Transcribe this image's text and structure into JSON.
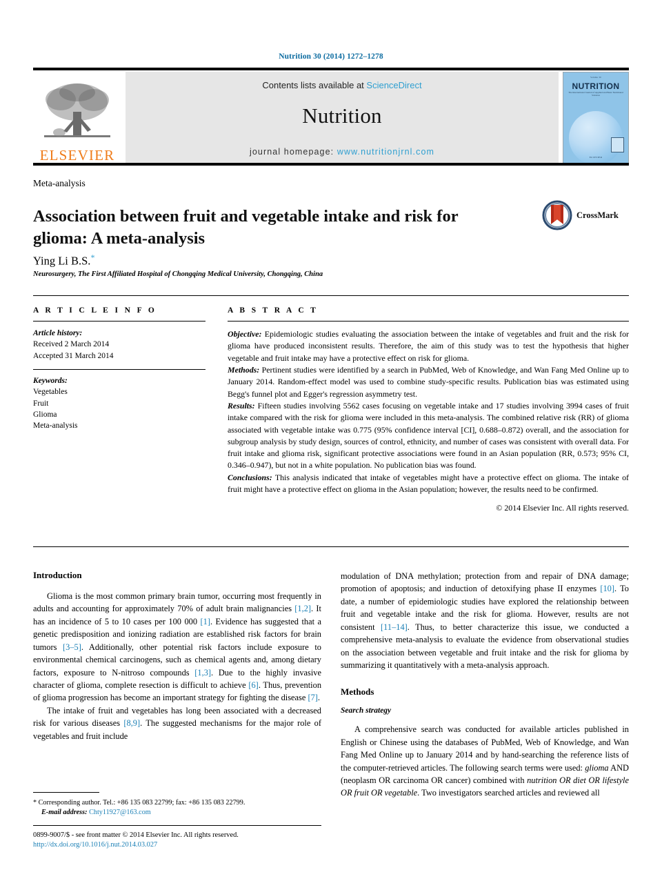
{
  "running_head": "Nutrition 30 (2014) 1272–1278",
  "masthead": {
    "publisher_name": "ELSEVIER",
    "contents_prefix": "Contents lists available at ",
    "contents_link": "ScienceDirect",
    "journal_title": "Nutrition",
    "homepage_prefix": "journal homepage: ",
    "homepage_url": "www.nutritionjrnl.com",
    "cover": {
      "volume_line": "Volume 30",
      "title": "NUTRITION",
      "subtitle": "The International Journal of Applied and Basic Nutritional Sciences",
      "footer": "ELSEVIER"
    },
    "link_color": "#2f9fd0"
  },
  "article": {
    "type": "Meta-analysis",
    "title": "Association between fruit and vegetable intake and risk for glioma: A meta-analysis",
    "author": "Ying Li B.S.",
    "author_marker": "*",
    "affiliation": "Neurosurgery, The First Affiliated Hospital of Chongqing Medical University, Chongqing, China",
    "crossmark_label": "CrossMark"
  },
  "article_info": {
    "heading": "A R T I C L E   I N F O",
    "history_label": "Article history:",
    "history": [
      "Received 2 March 2014",
      "Accepted 31 March 2014"
    ],
    "keywords_label": "Keywords:",
    "keywords": [
      "Vegetables",
      "Fruit",
      "Glioma",
      "Meta-analysis"
    ]
  },
  "abstract": {
    "heading": "A B S T R A C T",
    "sections": [
      {
        "lead": "Objective:",
        "text": " Epidemiologic studies evaluating the association between the intake of vegetables and fruit and the risk for glioma have produced inconsistent results. Therefore, the aim of this study was to test the hypothesis that higher vegetable and fruit intake may have a protective effect on risk for glioma."
      },
      {
        "lead": "Methods:",
        "text": " Pertinent studies were identified by a search in PubMed, Web of Knowledge, and Wan Fang Med Online up to January 2014. Random-effect model was used to combine study-specific results. Publication bias was estimated using Begg's funnel plot and Egger's regression asymmetry test."
      },
      {
        "lead": "Results:",
        "text": " Fifteen studies involving 5562 cases focusing on vegetable intake and 17 studies involving 3994 cases of fruit intake compared with the risk for glioma were included in this meta-analysis. The combined relative risk (RR) of glioma associated with vegetable intake was 0.775 (95% confidence interval [CI], 0.688–0.872) overall, and the association for subgroup analysis by study design, sources of control, ethnicity, and number of cases was consistent with overall data. For fruit intake and glioma risk, significant protective associations were found in an Asian population (RR, 0.573; 95% CI, 0.346–0.947), but not in a white population. No publication bias was found."
      },
      {
        "lead": "Conclusions:",
        "text": " This analysis indicated that intake of vegetables might have a protective effect on glioma. The intake of fruit might have a protective effect on glioma in the Asian population; however, the results need to be confirmed."
      }
    ],
    "copyright": "© 2014 Elsevier Inc. All rights reserved."
  },
  "body": {
    "left": {
      "introduction_heading": "Introduction",
      "para1_a": "Glioma is the most common primary brain tumor, occurring most frequently in adults and accounting for approximately 70% of adult brain malignancies ",
      "ref1": "[1,2]",
      "para1_b": ". It has an incidence of 5 to 10 cases per 100 000 ",
      "ref2": "[1]",
      "para1_c": ". Evidence has suggested that a genetic predisposition and ionizing radiation are established risk factors for brain tumors ",
      "ref3": "[3–5]",
      "para1_d": ". Additionally, other potential risk factors include exposure to environmental chemical carcinogens, such as chemical agents and, among dietary factors, exposure to N-nitroso compounds ",
      "ref4": "[1,3]",
      "para1_e": ". Due to the highly invasive character of glioma, complete resection is difficult to achieve ",
      "ref5": "[6]",
      "para1_f": ". Thus, prevention of glioma progression has become an important strategy for fighting the disease ",
      "ref6": "[7]",
      "para1_g": ".",
      "para2_a": "The intake of fruit and vegetables has long been associated with a decreased risk for various diseases ",
      "ref7": "[8,9]",
      "para2_b": ". The suggested mechanisms for the major role of vegetables and fruit include"
    },
    "right": {
      "para1_a": "modulation of DNA methylation; protection from and repair of DNA damage; promotion of apoptosis; and induction of detoxifying phase II enzymes ",
      "ref1": "[10]",
      "para1_b": ". To date, a number of epidemiologic studies have explored the relationship between fruit and vegetable intake and the risk for glioma. However, results are not consistent ",
      "ref2": "[11–14]",
      "para1_c": ". Thus, to better characterize this issue, we conducted a comprehensive meta-analysis to evaluate the evidence from observational studies on the association between vegetable and fruit intake and the risk for glioma by summarizing it quantitatively with a meta-analysis approach.",
      "methods_heading": "Methods",
      "search_heading": "Search strategy",
      "para2_a": "A comprehensive search was conducted for available articles published in English or Chinese using the databases of PubMed, Web of Knowledge, and Wan Fang Med Online up to January 2014 and by hand-searching the reference lists of the computer-retrieved articles. The following search terms were used: ",
      "term1": "glioma",
      "para2_b": " AND (neoplasm OR carcinoma OR cancer) combined with ",
      "term2": "nutrition OR diet OR lifestyle OR fruit OR vegetable",
      "para2_c": ". Two investigators searched articles and reviewed all"
    }
  },
  "footnotes": {
    "marker": "*",
    "corresponding": " Corresponding author. Tel.: +86 135 083 22799; fax: +86 135 083 22799.",
    "email_label": "E-mail address:",
    "email": "Chty11927@163.com"
  },
  "footer": {
    "issn": "0899-9007/$ - see front matter © 2014 Elsevier Inc. All rights reserved.",
    "doi": "http://dx.doi.org/10.1016/j.nut.2014.03.027"
  }
}
